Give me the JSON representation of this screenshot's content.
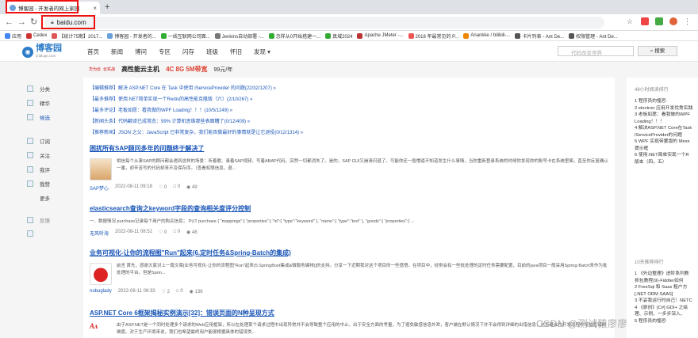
{
  "browser": {
    "tab_title": "博客园 - 开发者的网上家园",
    "url": "baidu.com",
    "bookmarks": [
      "应用",
      "Cedex",
      "【统计75期】2017...",
      "博客园 - 开发者的...",
      "一线互联网公司面...",
      "Jenkins自动部署 -...",
      "怎样从0开始搭建一...",
      "真域2024",
      "Apache JMeter -...",
      "2018 年最常见的 P...",
      "Anankke / bilibili-...",
      "卡片列表 - Ant De...",
      "权限管理 - Ant De..."
    ]
  },
  "site": {
    "logo_text": "博客园",
    "logo_sub": "cnblogs.com",
    "nav": [
      "首页",
      "新闻",
      "博问",
      "专区",
      "闪存",
      "班级",
      "怀旧",
      "发现 ▾"
    ],
    "search_placeholder": "代码改变世界",
    "search_button": "搜索",
    "banner": {
      "vendor": "华为云 ·云实战",
      "headline": "高性能云主机",
      "spec": "4C 8G 5M带宽",
      "price": "99元/年"
    }
  },
  "leftnav": [
    "分类",
    "精华",
    "候选",
    "订阅",
    "关注",
    "我评",
    "我赞",
    "更多",
    "反馈"
  ],
  "notices": [
    "【编辑推荐】解决 ASP.NET Core 在 Task 中使用 IServiceProvider 的问题(22/32/1207) »",
    "【最多推荐】使用.NET简单实现一个Redis的高性能克隆版（六）(2/10/267) »",
    "【最多评论】老板如愿：看我做的WPF Loading！！！(10/5/1249) »",
    "【新闻头条】代码翻译已成常态：99% 计算机思维那些表面糟了(0/12/409) »",
    "【推荐新闻】JSON 之父：JavaScript 已非常复杂，我们能否做最好的事情就是让它退役(0/12/1314) »"
  ],
  "posts": [
    {
      "title": "困扰所有SAP顾问多年的问题终于解决了",
      "desc": "相信每个从事SAP的顾问都会遇到这样的场景：听着歌、录着SAP视频、写着ABAP代码，突然一切都消失了。是的，SAP GUI又崩溃闪退了。可能你还一脸懵逼不知道发生什么事情，当你重新登录系统的时候你发现你的账号卡在系统里面，直至你反复确认一番，却辛苦写的代码却来不及保存序。（查看权限信息，退...",
      "author": "SAP梦心",
      "date": "2022-08-11 09:18",
      "likes": "0",
      "comments": "0",
      "views": "49"
    },
    {
      "title": "elasticsearch查询之keyword字段的查询相关度评分控制",
      "desc": "一、数据情况 purchase记录每个用户的购买信息； PUT purchase { \"mappings\":{ \"properties\":{ \"id\":{ \"type\":\"keyword\" }, \"name\":{ \"type\":\"text\" }, \"goods\":{ \"properties\":{ ...",
      "author": "无风听海",
      "date": "2022-08-11 08:52",
      "likes": "0",
      "comments": "0",
      "views": "48"
    },
    {
      "title": "业务可视化-让你的流程图\"Run\"起来(6.定时任务&Spring-Batch的集成)",
      "desc": "前言 首先，感谢大家对上一篇文章[业务可视化-让你的流程图\"Run\"起来(5.SpringBoot集成&微服务编排)]的支持。分享一下近期我对这个项目的一些感悟。在项目中，经常会有一些批处理的定时任务需要配置，目前的java项目一般采用Spring-Batch来作为批处理的平台。但是Sprin...",
      "author": "nobuglady",
      "date": "2022-08-11 08:33",
      "likes": "2",
      "comments": "0",
      "views": "136"
    },
    {
      "title": "ASP.NET Core 6框架揭秘实例演示[32]：错误页面的N种呈现方式",
      "desc": "由于ASP.NET是一个同时处理多个请求的Web应用框架，所以在处理某个请求过程中出现异常并不会导致整个应用的中止。出于安全方面的考量，为了避免敏感信息外泄，客户端在默认情况下并不会得到详细的出错信息，这无疑会在开发过程中增加查错的难度。对于生产环境来说，我们也希望最终用户能够根据具体的错误类...",
      "author": "",
      "date": "",
      "likes": "",
      "comments": "",
      "views": ""
    }
  ],
  "sidebar": {
    "heading1": "48小时阅读排行",
    "list1": [
      "1 程序员的惶恐",
      "2 electron 应用开发优秀实践",
      "3 老板如愿：看我做的WPF",
      "  Loading！！！",
      "4 解决ASP.NET Core在Task",
      "  IServiceProvider的问题",
      "5 WPF 实现带蒙版的 Mess",
      "  提示框",
      "6 使用.NET简单实现一个R",
      "  版本（四，五）"
    ],
    "heading2": "10天推荐排行",
    "list2": [
      "1 《外边整理》进阶系列教",
      "  抓包教程(9)-Fiddler如何",
      "2 FreeSql 和 Saas 租户方",
      "  [.NET ORM SAAS]",
      "3 不妥我运行时自己！NETC",
      "4 《原创》[C#] GDI+ 之绘",
      "  理、示例、一步步深入、",
      "5 程序员的惶恐"
    ]
  },
  "watermark": "CSDN @测试猿廖廖"
}
